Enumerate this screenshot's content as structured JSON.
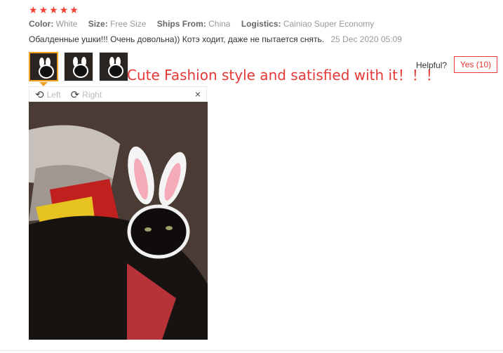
{
  "rating": {
    "stars": 5,
    "color": "#f44336"
  },
  "meta": {
    "color_label": "Color:",
    "color_value": "White",
    "size_label": "Size:",
    "size_value": "Free Size",
    "ships_label": "Ships From:",
    "ships_value": "China",
    "logistics_label": "Logistics:",
    "logistics_value": "Cainiao Super Economy"
  },
  "review": {
    "text": "Обалденные ушки!!! Очень довольна)) Котэ ходит, даже не пытается снять.",
    "date": "25 Dec 2020 05:09"
  },
  "caption": "Cute Fashion style and satisfied with it！！！",
  "helpful": {
    "label": "Helpful?",
    "yes_button": "Yes (10)"
  },
  "viewer": {
    "rotate_left": "Left",
    "rotate_right": "Right",
    "close": "×"
  },
  "photo": {
    "subject": "black cat wearing white bunny-ear headband"
  },
  "colors": {
    "accent": "#e53935",
    "thumb_active": "#f0a020"
  }
}
